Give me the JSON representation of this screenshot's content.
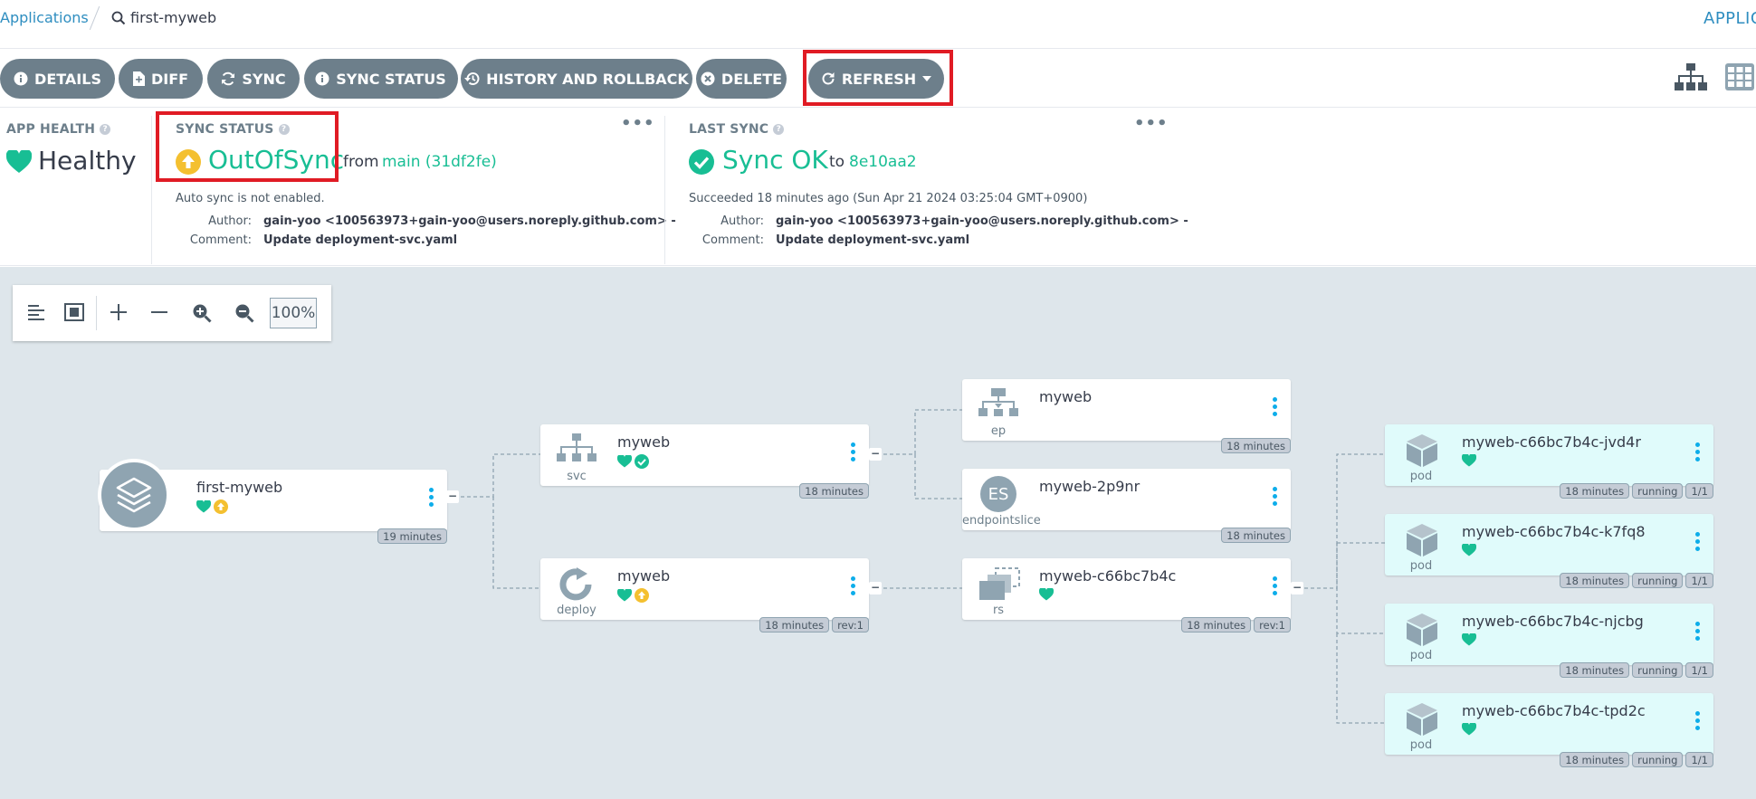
{
  "breadcrumb": {
    "applications": "Applications",
    "app_name": "first-myweb"
  },
  "header_right": "APPLIC",
  "toolbar": {
    "details": "DETAILS",
    "diff": "DIFF",
    "sync": "SYNC",
    "sync_status": "SYNC STATUS",
    "history": "HISTORY AND ROLLBACK",
    "delete": "DELETE",
    "refresh": "REFRESH"
  },
  "app_health": {
    "label": "APP HEALTH",
    "value": "Healthy"
  },
  "sync_status": {
    "label": "SYNC STATUS",
    "value": "OutOfSync",
    "from_word": "from",
    "revision": "main (31df2fe)",
    "auto_sync": "Auto sync is not enabled.",
    "author_key": "Author:",
    "author": "gain-yoo <100563973+gain-yoo@users.noreply.github.com> -",
    "comment_key": "Comment:",
    "comment": "Update deployment-svc.yaml"
  },
  "last_sync": {
    "label": "LAST SYNC",
    "value": "Sync OK",
    "to_word": "to",
    "revision": "8e10aa2",
    "succeeded": "Succeeded 18 minutes ago (Sun Apr 21 2024 03:25:04 GMT+0900)",
    "author_key": "Author:",
    "author": "gain-yoo <100563973+gain-yoo@users.noreply.github.com> -",
    "comment_key": "Comment:",
    "comment": "Update deployment-svc.yaml"
  },
  "zoom": {
    "level": "100%"
  },
  "nodes": {
    "app": {
      "name": "first-myweb",
      "age": "19 minutes"
    },
    "svc": {
      "name": "myweb",
      "kind": "svc",
      "age": "18 minutes"
    },
    "deploy": {
      "name": "myweb",
      "kind": "deploy",
      "age": "18 minutes",
      "rev": "rev:1"
    },
    "ep": {
      "name": "myweb",
      "kind": "ep",
      "age": "18 minutes"
    },
    "epslice": {
      "name": "myweb-2p9nr",
      "kind": "endpointslice",
      "icon_text": "ES",
      "age": "18 minutes"
    },
    "rs": {
      "name": "myweb-c66bc7b4c",
      "kind": "rs",
      "age": "18 minutes",
      "rev": "rev:1"
    },
    "pod1": {
      "name": "myweb-c66bc7b4c-jvd4r",
      "kind": "pod",
      "age": "18 minutes",
      "status": "running",
      "ready": "1/1"
    },
    "pod2": {
      "name": "myweb-c66bc7b4c-k7fq8",
      "kind": "pod",
      "age": "18 minutes",
      "status": "running",
      "ready": "1/1"
    },
    "pod3": {
      "name": "myweb-c66bc7b4c-njcbg",
      "kind": "pod",
      "age": "18 minutes",
      "status": "running",
      "ready": "1/1"
    },
    "pod4": {
      "name": "myweb-c66bc7b4c-tpd2c",
      "kind": "pod",
      "age": "18 minutes",
      "status": "running",
      "ready": "1/1"
    }
  },
  "colors": {
    "healthy": "#18be94",
    "out_of_sync": "#f4c030",
    "accent": "#2f8ec0",
    "button": "#6d7f8b"
  }
}
